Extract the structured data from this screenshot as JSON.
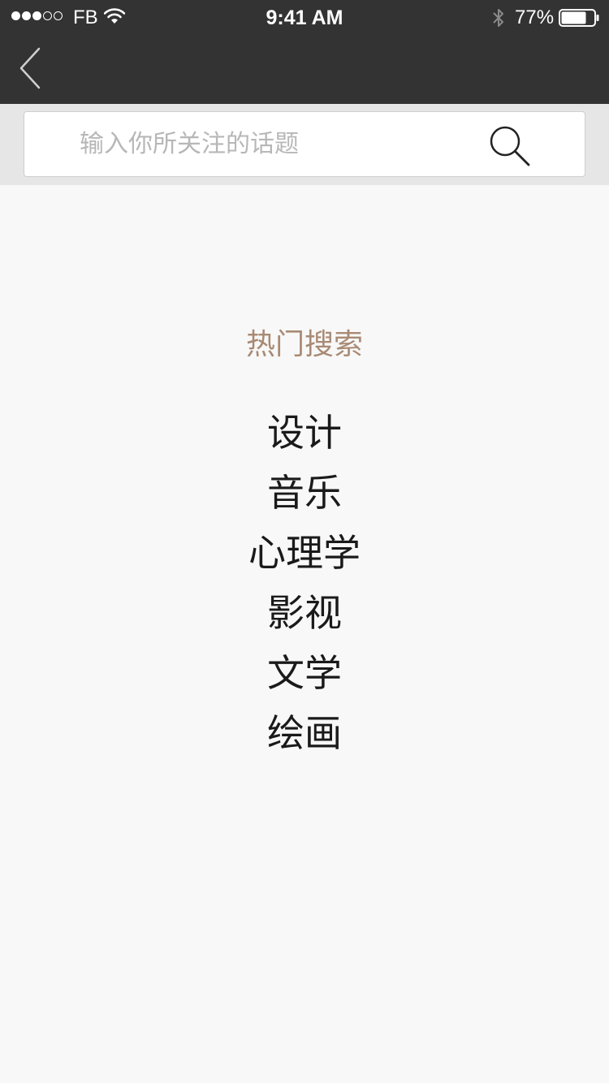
{
  "status_bar": {
    "carrier": "FB",
    "time": "9:41 AM",
    "battery_percent": "77%",
    "battery_level": 0.77,
    "signal_bars": 3,
    "signal_total": 5
  },
  "nav": {
    "back_icon": "chevron-left-icon"
  },
  "search": {
    "placeholder": "输入你所关注的话题",
    "value": "",
    "icon": "search-icon"
  },
  "hot_search": {
    "title": "热门搜索",
    "items": [
      "设计",
      "音乐",
      "心理学",
      "影视",
      "文学",
      "绘画"
    ]
  },
  "colors": {
    "top_bar": "#333333",
    "search_band": "#e6e6e6",
    "background": "#f8f8f8",
    "hot_title": "#a98a74"
  }
}
